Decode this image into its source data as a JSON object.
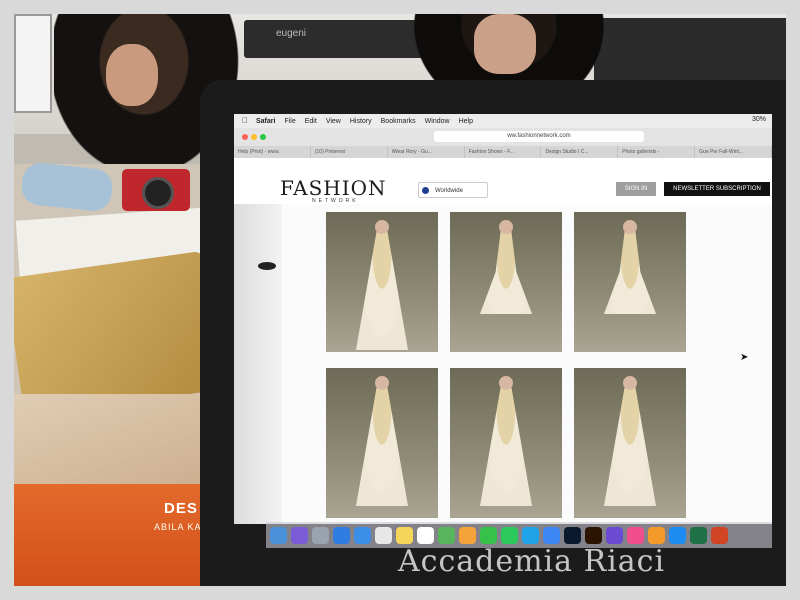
{
  "background": {
    "monitor_brand": "eugeni",
    "book_title": "DES",
    "book_subtitle": "ABILA KA"
  },
  "browser": {
    "menubar": {
      "apple": "",
      "items": [
        "Safari",
        "File",
        "Edit",
        "View",
        "History",
        "Bookmarks",
        "Window",
        "Help"
      ],
      "battery": "30%"
    },
    "url": "ww.fashionnetwork.com",
    "tabs": [
      "Help (Print) - www.",
      "(10) Pinterest",
      "iWear Rory - Gu...",
      "Fashion Shows - F...",
      "Design Studio I C...",
      "Photo gallerists -",
      "Gue Per Fall-Wint..."
    ]
  },
  "site": {
    "logo": "FASHION",
    "logo_sub": "NETWORK",
    "region": "Worldwide",
    "sign_in": "SIGN IN",
    "newsletter": "NEWSLETTER SUBSCRIPTION"
  },
  "watermark": "Accademia Riaci",
  "colors": {
    "camera": "#c0272d",
    "book_cover": "#e36a2b",
    "newsletter_button": "#111111",
    "sign_in_button": "#9e9e9e"
  },
  "dock_icons": [
    "finder-icon",
    "siri-icon",
    "launchpad-icon",
    "safari-icon",
    "mail-icon",
    "calendar-icon",
    "notes-icon",
    "reminders-icon",
    "maps-icon",
    "photos-icon",
    "messages-icon",
    "facetime-icon",
    "skype-icon",
    "messenger-icon",
    "photoshop-icon",
    "illustrator-icon",
    "imovie-icon",
    "itunes-icon",
    "ibooks-icon",
    "app-store-icon",
    "excel-icon",
    "powerpoint-icon"
  ]
}
